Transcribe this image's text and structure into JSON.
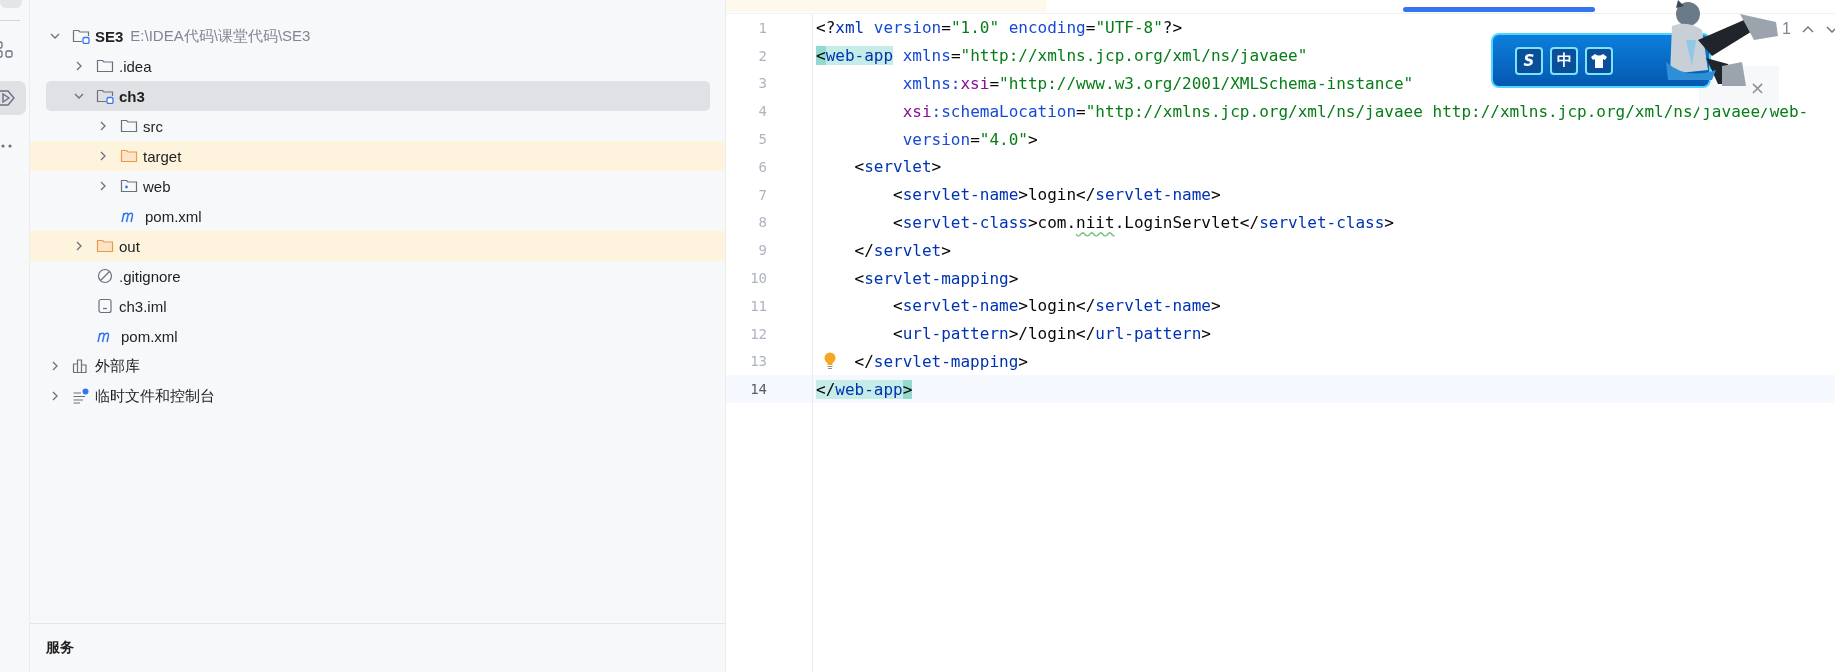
{
  "activity_bar": [
    {
      "kind": "tool",
      "selected": false
    },
    {
      "kind": "structure",
      "selected": false
    },
    {
      "kind": "services",
      "selected": true
    },
    {
      "kind": "more",
      "selected": false
    }
  ],
  "project_tree": [
    {
      "label": "SE3",
      "kind": "module",
      "hint": "E:\\IDEA代码\\课堂代码\\SE3",
      "expanded": true,
      "selected": false,
      "excluded": false,
      "children": [
        {
          "label": ".idea",
          "kind": "folder",
          "expanded": false,
          "selected": false,
          "excluded": false
        },
        {
          "label": "ch3",
          "kind": "module",
          "expanded": true,
          "selected": true,
          "excluded": false,
          "children": [
            {
              "label": "src",
              "kind": "folder",
              "expanded": false,
              "selected": false,
              "excluded": false
            },
            {
              "label": "target",
              "kind": "folder",
              "expanded": false,
              "selected": false,
              "excluded": true
            },
            {
              "label": "web",
              "kind": "web",
              "expanded": false,
              "selected": false,
              "excluded": false
            },
            {
              "label": "pom.xml",
              "kind": "maven",
              "selected": false,
              "excluded": false
            }
          ]
        },
        {
          "label": "out",
          "kind": "folder",
          "expanded": false,
          "selected": false,
          "excluded": true
        },
        {
          "label": ".gitignore",
          "kind": "gitignore",
          "selected": false,
          "excluded": false
        },
        {
          "label": "ch3.iml",
          "kind": "iml",
          "selected": false,
          "excluded": false
        },
        {
          "label": "pom.xml",
          "kind": "maven",
          "selected": false,
          "excluded": false
        }
      ]
    },
    {
      "label": "外部库",
      "kind": "library",
      "expanded": false,
      "selected": false,
      "excluded": false
    },
    {
      "label": "临时文件和控制台",
      "kind": "scratch",
      "expanded": false,
      "selected": false,
      "excluded": false
    }
  ],
  "bottom_panel": {
    "title": "服务"
  },
  "editor": {
    "lines": [
      {
        "number": "1",
        "current": false,
        "hint": false,
        "tokens": [
          {
            "text": "<?",
            "kind": "punct"
          },
          {
            "text": "xml",
            "kind": "tag"
          },
          {
            "text": " version",
            "kind": "attr"
          },
          {
            "text": "=",
            "kind": "punct"
          },
          {
            "text": "\"1.0\"",
            "kind": "value"
          },
          {
            "text": " encoding",
            "kind": "attr"
          },
          {
            "text": "=",
            "kind": "punct"
          },
          {
            "text": "\"UTF-8\"",
            "kind": "value"
          },
          {
            "text": "?>",
            "kind": "punct"
          }
        ]
      },
      {
        "number": "2",
        "current": false,
        "hint": false,
        "tokens": [
          {
            "text": "<",
            "kind": "match-edge"
          },
          {
            "text": "web-app",
            "kind": "match"
          },
          {
            "text": " xmlns",
            "kind": "attr"
          },
          {
            "text": "=",
            "kind": "punct"
          },
          {
            "text": "\"http://xmlns.jcp.org/xml/ns/javaee\"",
            "kind": "value"
          }
        ]
      },
      {
        "number": "3",
        "current": false,
        "hint": false,
        "tokens": [
          {
            "text": "         xmlns:",
            "kind": "attr"
          },
          {
            "text": "xsi",
            "kind": "ns"
          },
          {
            "text": "=",
            "kind": "punct"
          },
          {
            "text": "\"http://www.w3.org/2001/XMLSchema-instance\"",
            "kind": "value"
          }
        ]
      },
      {
        "number": "4",
        "current": false,
        "hint": false,
        "tokens": [
          {
            "text": "         xsi",
            "kind": "ns"
          },
          {
            "text": ":schemaLocation",
            "kind": "attr"
          },
          {
            "text": "=",
            "kind": "punct"
          },
          {
            "text": "\"http://xmlns.jcp.org/xml/ns/javaee http://xmlns.jcp.org/xml/ns/javaee/web-",
            "kind": "value"
          }
        ]
      },
      {
        "number": "5",
        "current": false,
        "hint": false,
        "tokens": [
          {
            "text": "         version",
            "kind": "attr"
          },
          {
            "text": "=",
            "kind": "punct"
          },
          {
            "text": "\"4.0\"",
            "kind": "value"
          },
          {
            "text": ">",
            "kind": "punct"
          }
        ]
      },
      {
        "number": "6",
        "current": false,
        "hint": false,
        "tokens": [
          {
            "text": "    <",
            "kind": "punct"
          },
          {
            "text": "servlet",
            "kind": "tag"
          },
          {
            "text": ">",
            "kind": "punct"
          }
        ]
      },
      {
        "number": "7",
        "current": false,
        "hint": false,
        "tokens": [
          {
            "text": "        <",
            "kind": "punct"
          },
          {
            "text": "servlet-name",
            "kind": "tag"
          },
          {
            "text": ">login</",
            "kind": "punct"
          },
          {
            "text": "servlet-name",
            "kind": "tag"
          },
          {
            "text": ">",
            "kind": "punct"
          }
        ]
      },
      {
        "number": "8",
        "current": false,
        "hint": false,
        "tokens": [
          {
            "text": "        <",
            "kind": "punct"
          },
          {
            "text": "servlet-class",
            "kind": "tag"
          },
          {
            "text": ">com.",
            "kind": "punct"
          },
          {
            "text": "niit",
            "kind": "typo"
          },
          {
            "text": ".LoginServlet</",
            "kind": "punct"
          },
          {
            "text": "servlet-class",
            "kind": "tag"
          },
          {
            "text": ">",
            "kind": "punct"
          }
        ]
      },
      {
        "number": "9",
        "current": false,
        "hint": false,
        "tokens": [
          {
            "text": "    </",
            "kind": "punct"
          },
          {
            "text": "servlet",
            "kind": "tag"
          },
          {
            "text": ">",
            "kind": "punct"
          }
        ]
      },
      {
        "number": "10",
        "current": false,
        "hint": false,
        "tokens": [
          {
            "text": "    <",
            "kind": "punct"
          },
          {
            "text": "servlet-mapping",
            "kind": "tag"
          },
          {
            "text": ">",
            "kind": "punct"
          }
        ]
      },
      {
        "number": "11",
        "current": false,
        "hint": false,
        "tokens": [
          {
            "text": "        <",
            "kind": "punct"
          },
          {
            "text": "servlet-name",
            "kind": "tag"
          },
          {
            "text": ">login</",
            "kind": "punct"
          },
          {
            "text": "servlet-name",
            "kind": "tag"
          },
          {
            "text": ">",
            "kind": "punct"
          }
        ]
      },
      {
        "number": "12",
        "current": false,
        "hint": false,
        "tokens": [
          {
            "text": "        <",
            "kind": "punct"
          },
          {
            "text": "url-pattern",
            "kind": "tag"
          },
          {
            "text": ">/login</",
            "kind": "punct"
          },
          {
            "text": "url-pattern",
            "kind": "tag"
          },
          {
            "text": ">",
            "kind": "punct"
          }
        ]
      },
      {
        "number": "13",
        "current": false,
        "hint": true,
        "tokens": [
          {
            "text": "    </",
            "kind": "punct"
          },
          {
            "text": "servlet-mapping",
            "kind": "tag"
          },
          {
            "text": ">",
            "kind": "punct"
          }
        ]
      },
      {
        "number": "14",
        "current": true,
        "hint": false,
        "tokens": [
          {
            "text": "</",
            "kind": "match-punct"
          },
          {
            "text": "web-app",
            "kind": "match"
          },
          {
            "text": ">",
            "kind": "match-edge"
          }
        ]
      }
    ]
  },
  "find_bar": {
    "result_count": "1",
    "close": "×"
  },
  "ime_toolbar": {
    "buttons": [
      {
        "kind": "logo",
        "label": "S"
      },
      {
        "kind": "text",
        "label": "中"
      },
      {
        "kind": "skin"
      }
    ]
  }
}
